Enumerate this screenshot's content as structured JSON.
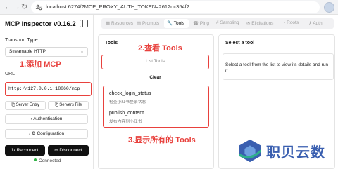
{
  "browser": {
    "url": "localhost:6274/?MCP_PROXY_AUTH_TOKEN=2612dc354f2..."
  },
  "sidebar": {
    "title": "MCP Inspector v0.16.2",
    "transport_label": "Transport Type",
    "transport_value": "Streamable HTTP",
    "url_label": "URL",
    "url_value": "http://127.0.0.1:18060/mcp",
    "server_entry_label": "Server Entry",
    "servers_file_label": "Servers File",
    "authentication_label": "Authentication",
    "configuration_label": "Configuration",
    "reconnect_label": "Reconnect",
    "disconnect_label": "Disconnect",
    "status_text": "Connected"
  },
  "annotations": {
    "step1": "1.添加 MCP",
    "step2": "2.查看 Tools",
    "step3": "3.显示所有的 Tools"
  },
  "tabs": [
    {
      "label": "Resources",
      "active": false
    },
    {
      "label": "Prompts",
      "active": false
    },
    {
      "label": "Tools",
      "active": true
    },
    {
      "label": "Ping",
      "active": false
    },
    {
      "label": "Sampling",
      "active": false
    },
    {
      "label": "Elicitations",
      "active": false
    },
    {
      "label": "Roots",
      "active": false
    },
    {
      "label": "Auth",
      "active": false
    }
  ],
  "tools_panel": {
    "title": "Tools",
    "list_button": "List Tools",
    "clear_button": "Clear",
    "items": [
      {
        "name": "check_login_status",
        "description": "检查小红书登录状态"
      },
      {
        "name": "publish_content",
        "description": "发布内容到小红书"
      }
    ]
  },
  "detail_panel": {
    "title": "Select a tool",
    "hint": "Select a tool from the list to view its details and run it"
  },
  "watermark": {
    "text": "职贝云数"
  },
  "colors": {
    "annotation_red": "#e8413d",
    "connected_green": "#2fb344",
    "watermark_blue": "#3a5fb0"
  }
}
